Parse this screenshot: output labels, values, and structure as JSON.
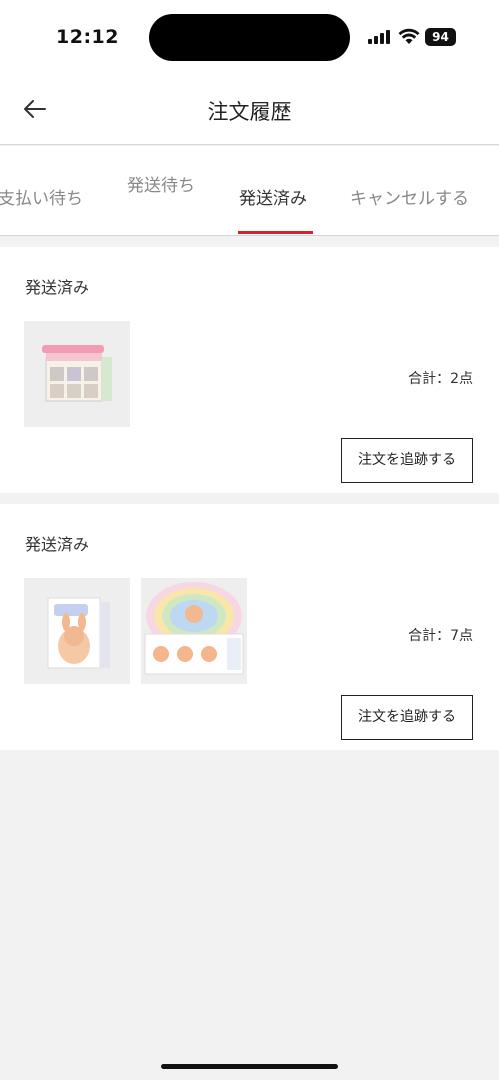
{
  "status_bar": {
    "time": "12:12",
    "battery": "94"
  },
  "header": {
    "title": "注文履歴"
  },
  "tabs": [
    {
      "label": "支払い待ち"
    },
    {
      "label": "発送待ち"
    },
    {
      "label": "発送済み",
      "active": true
    },
    {
      "label": "キャンセルする"
    }
  ],
  "orders": [
    {
      "status": "発送済み",
      "total": "合計：2点",
      "track_label": "注文を追跡する",
      "thumbnail_count": 1
    },
    {
      "status": "発送済み",
      "total": "合計：7点",
      "track_label": "注文を追跡する",
      "thumbnail_count": 2
    }
  ],
  "colors": {
    "accent": "#d6242f",
    "background": "#f2f2f2"
  }
}
